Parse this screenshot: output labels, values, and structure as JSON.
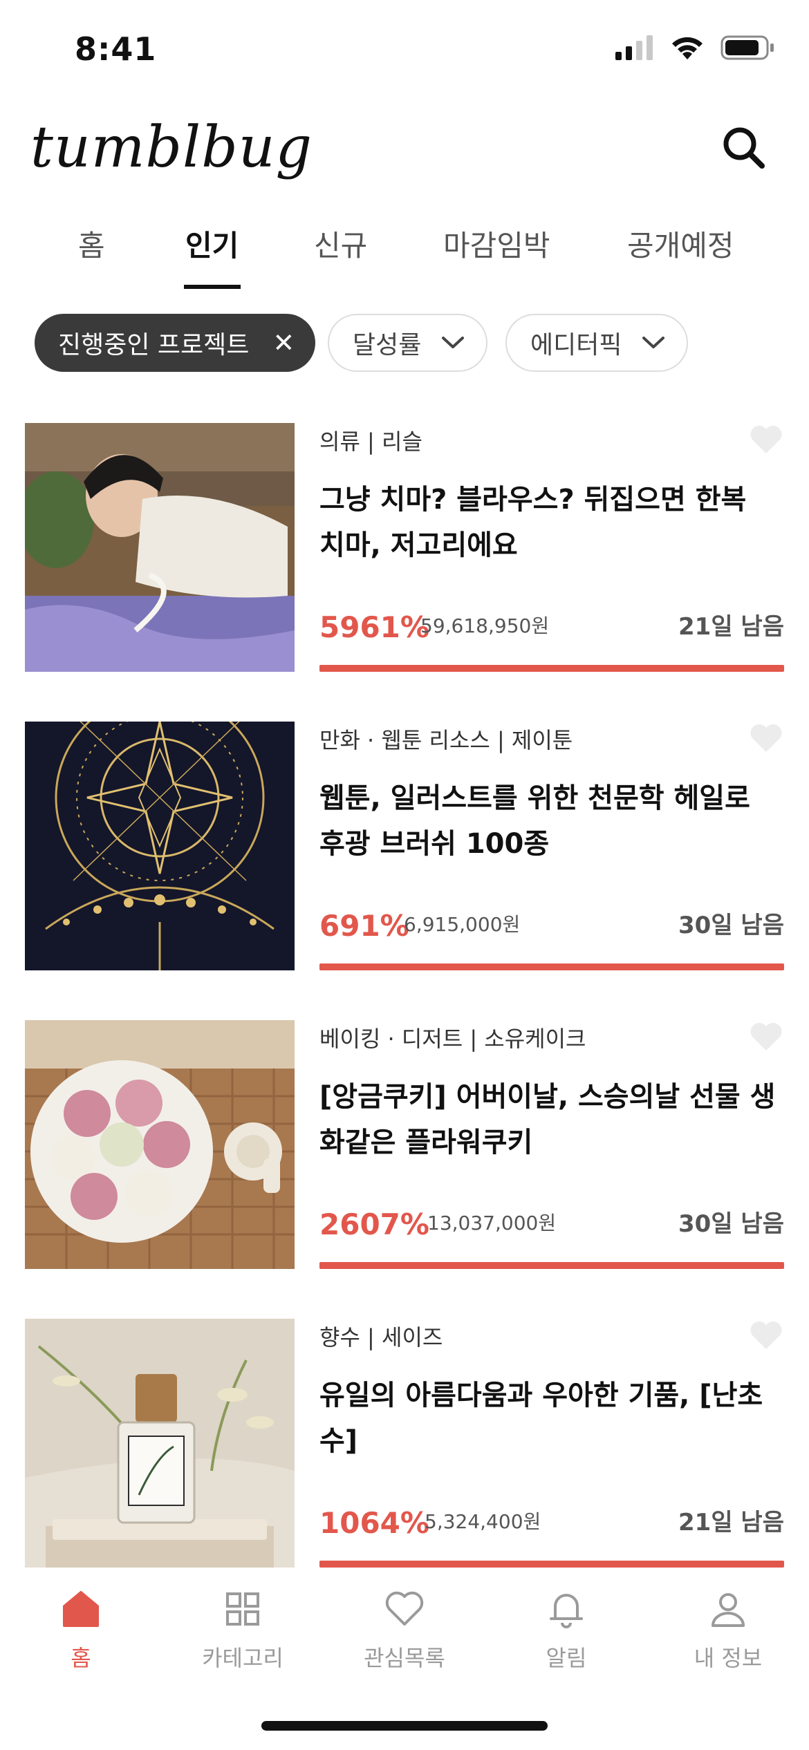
{
  "status_bar": {
    "time": "8:41"
  },
  "header": {
    "logo": "tumblbug",
    "search_icon": "search-icon"
  },
  "tabs": [
    {
      "label": "홈",
      "active": false
    },
    {
      "label": "인기",
      "active": true
    },
    {
      "label": "신규",
      "active": false
    },
    {
      "label": "마감임박",
      "active": false
    },
    {
      "label": "공개예정",
      "active": false
    }
  ],
  "filters": {
    "active_chip": {
      "label": "진행중인 프로젝트",
      "close_icon": "close-icon"
    },
    "rate_chip": {
      "label": "달성률",
      "icon": "chevron-down-icon"
    },
    "editor_chip": {
      "label": "에디터픽",
      "icon": "chevron-down-icon"
    }
  },
  "projects": [
    {
      "category": "의류 | 리슬",
      "title": "그냥 치마? 블라우스? 뒤집으면 한복 치마, 저고리에요",
      "percent": "5961%",
      "amount": "59,618,950원",
      "remaining": "21일 남음",
      "progress": 1.0
    },
    {
      "category": "만화 · 웹툰 리소스 | 제이툰",
      "title": "웹툰, 일러스트를 위한 천문학 헤일로 후광 브러쉬 100종",
      "percent": "691%",
      "amount": "6,915,000원",
      "remaining": "30일 남음",
      "progress": 1.0
    },
    {
      "category": "베이킹 · 디저트 | 소유케이크",
      "title": "[앙금쿠키] 어버이날, 스승의날 선물 생화같은 플라워쿠키",
      "percent": "2607%",
      "amount": "13,037,000원",
      "remaining": "30일 남음",
      "progress": 1.0
    },
    {
      "category": "향수 | 세이즈",
      "title": "유일의 아름다움과 우아한 기품, [난초수]",
      "percent": "1064%",
      "amount": "5,324,400원",
      "remaining": "21일 남음",
      "progress": 1.0
    }
  ],
  "bottom_nav": [
    {
      "label": "홈",
      "icon": "home-icon",
      "active": true
    },
    {
      "label": "카테고리",
      "icon": "grid-icon",
      "active": false
    },
    {
      "label": "관심목록",
      "icon": "heart-icon",
      "active": false
    },
    {
      "label": "알림",
      "icon": "bell-icon",
      "active": false
    },
    {
      "label": "내 정보",
      "icon": "person-icon",
      "active": false
    }
  ],
  "colors": {
    "accent": "#e2574c",
    "chip_dark": "#3a3a3a",
    "inactive_nav": "#9a9a9a"
  }
}
